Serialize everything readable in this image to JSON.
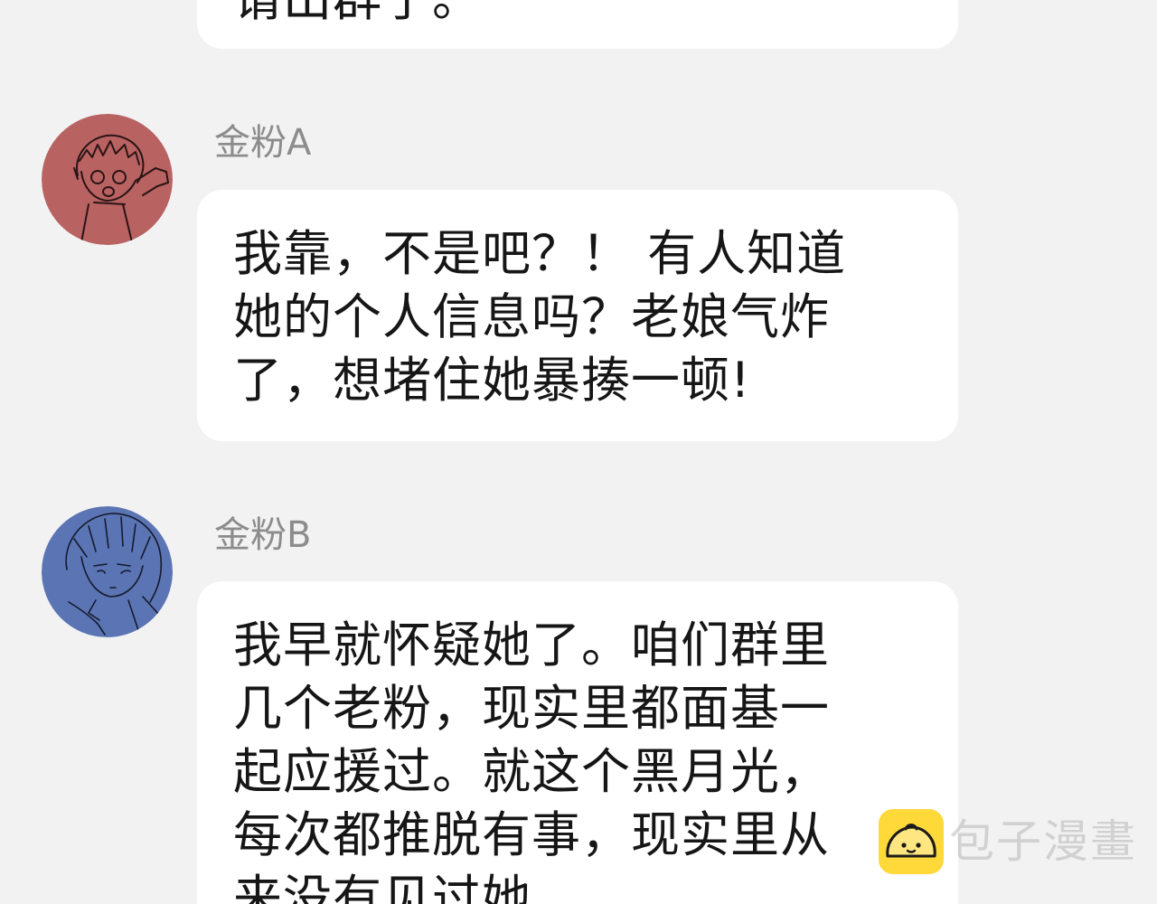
{
  "messages": [
    {
      "sender": "",
      "text": "请出群了。"
    },
    {
      "sender": "金粉A",
      "text": "我靠，不是吧？！ 有人知道\n她的个人信息吗？老娘气炸\n了，想堵住她暴揍一顿!"
    },
    {
      "sender": "金粉B",
      "text": "我早就怀疑她了。咱们群里\n几个老粉，现实里都面基一\n起应援过。就这个黑月光，\n每次都推脱有事，现实里从\n来没有见过她"
    }
  ],
  "avatars": [
    {
      "icon": "avatar-red-boy-sketch-icon",
      "color": "#b86262"
    },
    {
      "icon": "avatar-blue-boy-sketch-icon",
      "color": "#5b74b4"
    }
  ],
  "watermark": {
    "text": "包子漫畫",
    "icon": "baozi-logo-icon",
    "color": "#ffd83a"
  }
}
